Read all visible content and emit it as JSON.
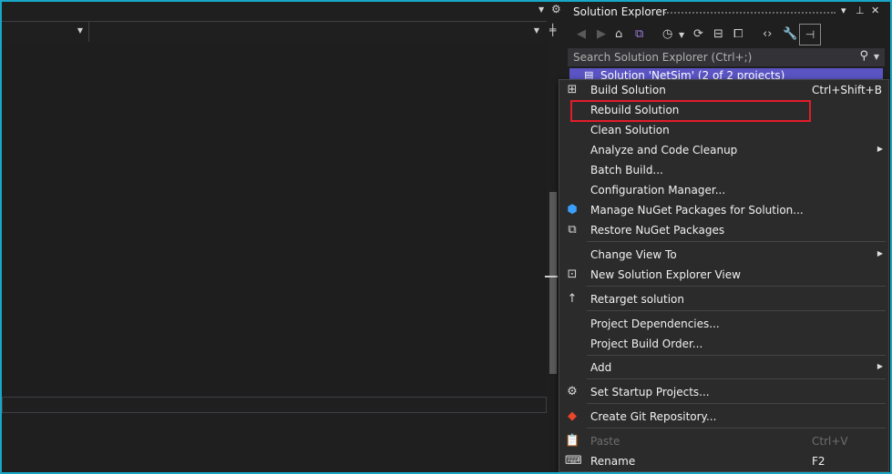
{
  "solution_explorer": {
    "title": "Solution Explorer",
    "pin_label": "▾",
    "pin_icon": "⊥",
    "close_label": "✕",
    "search_placeholder": "Search Solution Explorer (Ctrl+;)",
    "solution_item": "Solution 'NetSim' (2 of 2 projects)"
  },
  "context_menu": {
    "items": [
      {
        "label": "Build Solution",
        "shortcut": "Ctrl+Shift+B",
        "icon": "build-icon"
      },
      {
        "label": "Rebuild Solution",
        "shortcut": "",
        "icon": ""
      },
      {
        "label": "Clean Solution",
        "shortcut": "",
        "icon": ""
      },
      {
        "label": "Analyze and Code Cleanup",
        "shortcut": "",
        "icon": "",
        "submenu": true
      },
      {
        "label": "Batch Build...",
        "shortcut": "",
        "icon": ""
      },
      {
        "label": "Configuration Manager...",
        "shortcut": "",
        "icon": ""
      },
      {
        "label": "Manage NuGet Packages for Solution...",
        "shortcut": "",
        "icon": "nuget-icon"
      },
      {
        "label": "Restore NuGet Packages",
        "shortcut": "",
        "icon": "restore-packages-icon"
      },
      {
        "label": "Change View To",
        "shortcut": "",
        "icon": "",
        "submenu": true
      },
      {
        "label": "New Solution Explorer View",
        "shortcut": "",
        "icon": "new-view-icon"
      },
      {
        "label": "Retarget solution",
        "shortcut": "",
        "icon": "retarget-icon"
      },
      {
        "label": "Project Dependencies...",
        "shortcut": "",
        "icon": ""
      },
      {
        "label": "Project Build Order...",
        "shortcut": "",
        "icon": ""
      },
      {
        "label": "Add",
        "shortcut": "",
        "icon": "",
        "submenu": true
      },
      {
        "label": "Set Startup Projects...",
        "shortcut": "",
        "icon": "gear-icon"
      },
      {
        "label": "Create Git Repository...",
        "shortcut": "",
        "icon": "git-icon"
      },
      {
        "label": "Paste",
        "shortcut": "Ctrl+V",
        "icon": "paste-icon",
        "disabled": true
      },
      {
        "label": "Rename",
        "shortcut": "F2",
        "icon": "rename-icon"
      }
    ],
    "highlighted_item": "Rebuild Solution"
  },
  "colors": {
    "accent_frame": "#18a7c6",
    "selection": "#5b55c4",
    "highlight_box": "#e21c2a"
  }
}
